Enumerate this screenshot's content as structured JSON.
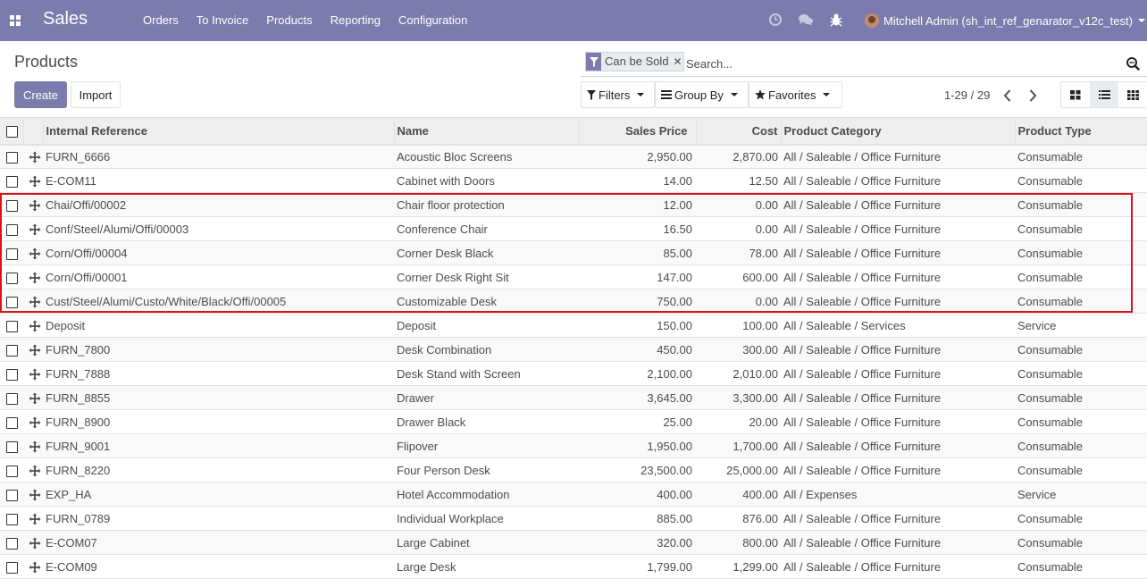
{
  "navbar": {
    "app_name": "Sales",
    "menu": [
      "Orders",
      "To Invoice",
      "Products",
      "Reporting",
      "Configuration"
    ],
    "icons": [
      "clock-icon",
      "chat-icon",
      "bug-icon"
    ],
    "user": "Mitchell Admin (sh_int_ref_genarator_v12c_test)",
    "color": "#7c7bad"
  },
  "page": {
    "title": "Products",
    "create_label": "Create",
    "import_label": "Import"
  },
  "search": {
    "facet_label": "Can be Sold",
    "placeholder": "Search..."
  },
  "filters": {
    "filters_label": "Filters",
    "groupby_label": "Group By",
    "favorites_label": "Favorites"
  },
  "pager": {
    "value": "1-29 / 29"
  },
  "table": {
    "columns": [
      "Internal Reference",
      "Name",
      "Sales Price",
      "Cost",
      "Product Category",
      "Product Type"
    ],
    "rows": [
      [
        "FURN_6666",
        "Acoustic Bloc Screens",
        "2,950.00",
        "2,870.00",
        "All / Saleable / Office Furniture",
        "Consumable"
      ],
      [
        "E-COM11",
        "Cabinet with Doors",
        "14.00",
        "12.50",
        "All / Saleable / Office Furniture",
        "Consumable"
      ],
      [
        "Chai/Offi/00002",
        "Chair floor protection",
        "12.00",
        "0.00",
        "All / Saleable / Office Furniture",
        "Consumable"
      ],
      [
        "Conf/Steel/Alumi/Offi/00003",
        "Conference Chair",
        "16.50",
        "0.00",
        "All / Saleable / Office Furniture",
        "Consumable"
      ],
      [
        "Corn/Offi/00004",
        "Corner Desk Black",
        "85.00",
        "78.00",
        "All / Saleable / Office Furniture",
        "Consumable"
      ],
      [
        "Corn/Offi/00001",
        "Corner Desk Right Sit",
        "147.00",
        "600.00",
        "All / Saleable / Office Furniture",
        "Consumable"
      ],
      [
        "Cust/Steel/Alumi/Custo/White/Black/Offi/00005",
        "Customizable Desk",
        "750.00",
        "0.00",
        "All / Saleable / Office Furniture",
        "Consumable"
      ],
      [
        "Deposit",
        "Deposit",
        "150.00",
        "100.00",
        "All / Saleable / Services",
        "Service"
      ],
      [
        "FURN_7800",
        "Desk Combination",
        "450.00",
        "300.00",
        "All / Saleable / Office Furniture",
        "Consumable"
      ],
      [
        "FURN_7888",
        "Desk Stand with Screen",
        "2,100.00",
        "2,010.00",
        "All / Saleable / Office Furniture",
        "Consumable"
      ],
      [
        "FURN_8855",
        "Drawer",
        "3,645.00",
        "3,300.00",
        "All / Saleable / Office Furniture",
        "Consumable"
      ],
      [
        "FURN_8900",
        "Drawer Black",
        "25.00",
        "20.00",
        "All / Saleable / Office Furniture",
        "Consumable"
      ],
      [
        "FURN_9001",
        "Flipover",
        "1,950.00",
        "1,700.00",
        "All / Saleable / Office Furniture",
        "Consumable"
      ],
      [
        "FURN_8220",
        "Four Person Desk",
        "23,500.00",
        "25,000.00",
        "All / Saleable / Office Furniture",
        "Consumable"
      ],
      [
        "EXP_HA",
        "Hotel Accommodation",
        "400.00",
        "400.00",
        "All / Expenses",
        "Service"
      ],
      [
        "FURN_0789",
        "Individual Workplace",
        "885.00",
        "876.00",
        "All / Saleable / Office Furniture",
        "Consumable"
      ],
      [
        "E-COM07",
        "Large Cabinet",
        "320.00",
        "800.00",
        "All / Saleable / Office Furniture",
        "Consumable"
      ],
      [
        "E-COM09",
        "Large Desk",
        "1,799.00",
        "1,299.00",
        "All / Saleable / Office Furniture",
        "Consumable"
      ]
    ]
  },
  "annotation": {
    "highlight_color": "#e0101a"
  }
}
